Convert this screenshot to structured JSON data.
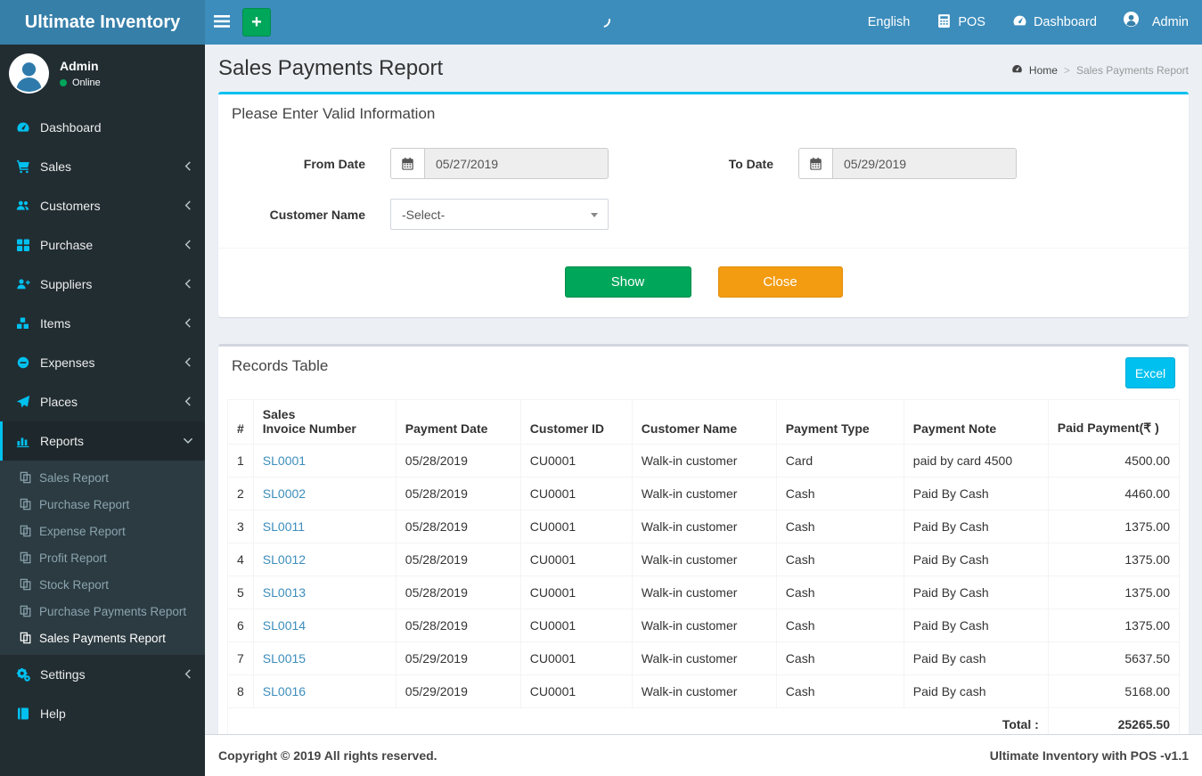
{
  "app": {
    "title": "Ultimate Inventory",
    "footer_left": "Copyright © 2019 All rights reserved.",
    "footer_right": "Ultimate Inventory with POS -v1.1"
  },
  "colors": {
    "navbar_blue": "#3c8dbc",
    "logo_blue": "#367fa9",
    "sidebar_dark": "#222d32",
    "accent_cyan": "#00c0ef",
    "success_green": "#00a65a",
    "warning_orange": "#f39c12",
    "link_blue": "#3c8dbc"
  },
  "topbar": {
    "plus_label": "+",
    "items": [
      {
        "label": "English",
        "icon": "none"
      },
      {
        "label": "POS",
        "icon": "calculator-icon"
      },
      {
        "label": "Dashboard",
        "icon": "tachometer-icon"
      },
      {
        "label": "Admin",
        "icon": "avatar-icon"
      }
    ]
  },
  "sidebar": {
    "user_name": "Admin",
    "user_status": "Online",
    "items": [
      {
        "label": "Dashboard",
        "icon": "tachometer-icon"
      },
      {
        "label": "Sales",
        "icon": "cart-icon"
      },
      {
        "label": "Customers",
        "icon": "users-icon"
      },
      {
        "label": "Purchase",
        "icon": "grid-icon"
      },
      {
        "label": "Suppliers",
        "icon": "user-plus-icon"
      },
      {
        "label": "Items",
        "icon": "cubes-icon"
      },
      {
        "label": "Expenses",
        "icon": "minus-circle-icon"
      },
      {
        "label": "Places",
        "icon": "paper-plane-icon"
      },
      {
        "label": "Reports",
        "icon": "bar-chart-icon"
      },
      {
        "label": "Settings",
        "icon": "gears-icon"
      },
      {
        "label": "Help",
        "icon": "book-icon"
      }
    ],
    "report_children": [
      "Sales Report",
      "Purchase Report",
      "Expense Report",
      "Profit Report",
      "Stock Report",
      "Purchase Payments Report",
      "Sales Payments Report"
    ]
  },
  "page": {
    "title": "Sales Payments Report",
    "breadcrumb_home": "Home",
    "breadcrumb_current": "Sales Payments Report"
  },
  "filter": {
    "heading": "Please Enter Valid Information",
    "from_date_label": "From Date",
    "from_date_value": "05/27/2019",
    "to_date_label": "To Date",
    "to_date_value": "05/29/2019",
    "customer_label": "Customer Name",
    "customer_value": "-Select-",
    "show_label": "Show",
    "close_label": "Close"
  },
  "records": {
    "heading": "Records Table",
    "excel_label": "Excel",
    "columns": [
      "#",
      "Sales\nInvoice Number",
      "Payment Date",
      "Customer ID",
      "Customer Name",
      "Payment Type",
      "Payment Note",
      "Paid Payment(₹ )"
    ],
    "rows": [
      {
        "num": "1",
        "invoice": "SL0001",
        "date": "05/28/2019",
        "customer_id": "CU0001",
        "customer_name": "Walk-in customer",
        "type": "Card",
        "note": "paid by card 4500",
        "amount": "4500.00"
      },
      {
        "num": "2",
        "invoice": "SL0002",
        "date": "05/28/2019",
        "customer_id": "CU0001",
        "customer_name": "Walk-in customer",
        "type": "Cash",
        "note": "Paid By Cash",
        "amount": "4460.00"
      },
      {
        "num": "3",
        "invoice": "SL0011",
        "date": "05/28/2019",
        "customer_id": "CU0001",
        "customer_name": "Walk-in customer",
        "type": "Cash",
        "note": "Paid By Cash",
        "amount": "1375.00"
      },
      {
        "num": "4",
        "invoice": "SL0012",
        "date": "05/28/2019",
        "customer_id": "CU0001",
        "customer_name": "Walk-in customer",
        "type": "Cash",
        "note": "Paid By Cash",
        "amount": "1375.00"
      },
      {
        "num": "5",
        "invoice": "SL0013",
        "date": "05/28/2019",
        "customer_id": "CU0001",
        "customer_name": "Walk-in customer",
        "type": "Cash",
        "note": "Paid By Cash",
        "amount": "1375.00"
      },
      {
        "num": "6",
        "invoice": "SL0014",
        "date": "05/28/2019",
        "customer_id": "CU0001",
        "customer_name": "Walk-in customer",
        "type": "Cash",
        "note": "Paid By Cash",
        "amount": "1375.00"
      },
      {
        "num": "7",
        "invoice": "SL0015",
        "date": "05/29/2019",
        "customer_id": "CU0001",
        "customer_name": "Walk-in customer",
        "type": "Cash",
        "note": "Paid By cash",
        "amount": "5637.50"
      },
      {
        "num": "8",
        "invoice": "SL0016",
        "date": "05/29/2019",
        "customer_id": "CU0001",
        "customer_name": "Walk-in customer",
        "type": "Cash",
        "note": "Paid By cash",
        "amount": "5168.00"
      }
    ],
    "total_label": "Total :",
    "total_value": "25265.50"
  }
}
